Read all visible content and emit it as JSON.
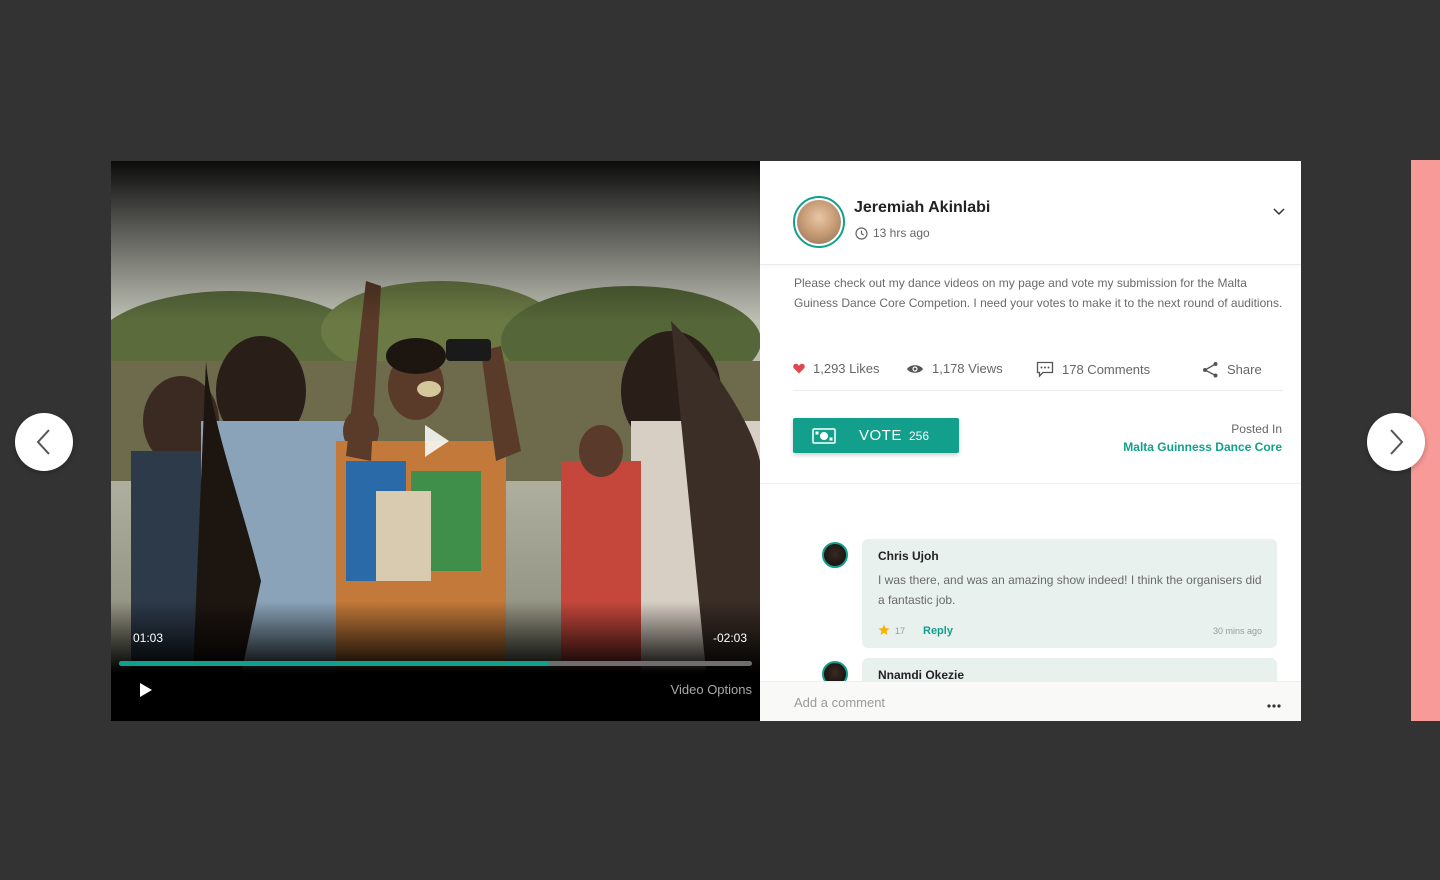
{
  "video": {
    "current_time": "01:03",
    "remaining_time": "-02:03",
    "progress_fraction": 0.68,
    "options_label": "Video Options"
  },
  "post": {
    "author": "Jeremiah Akinlabi",
    "time_ago": "13 hrs ago",
    "description": "Please check out my dance videos on my page and vote my submission for the Malta Guiness Dance Core Competion. I need your votes to make it to the next round of auditions.",
    "stats": {
      "likes": "1,293 Likes",
      "views": "1,178 Views",
      "comments": "178 Comments",
      "share": "Share"
    },
    "vote": {
      "label": "VOTE",
      "count": "256"
    },
    "posted_in": {
      "label": "Posted In",
      "group": "Malta Guinness Dance Core"
    }
  },
  "comments": [
    {
      "name": "Chris Ujoh",
      "text": "I was there, and was an amazing show indeed! I think the organisers did a fantastic job.",
      "likes": "17",
      "reply_label": "Reply",
      "time": "30 mins ago"
    },
    {
      "name": "Nnamdi Okezie"
    }
  ],
  "add_comment": {
    "placeholder": "Add a comment"
  },
  "icons": [
    "chevron-left-icon",
    "chevron-right-icon",
    "play-icon",
    "clock-icon",
    "chevron-down-icon",
    "heart-icon",
    "eye-icon",
    "comment-icon",
    "share-icon",
    "money-icon",
    "star-icon",
    "more-icon"
  ],
  "colors": {
    "accent": "#12a08c",
    "like": "#e0484f",
    "star": "#f5b400",
    "side_strip": "#f89a98",
    "backdrop": "#333333"
  }
}
